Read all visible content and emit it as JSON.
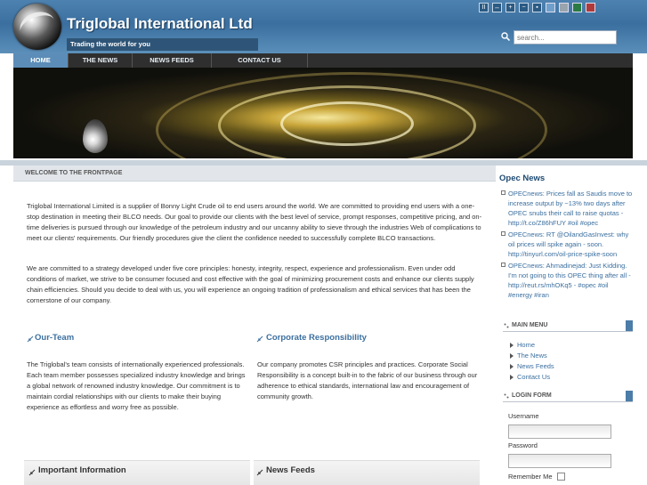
{
  "header": {
    "title": "Triglobal International Ltd",
    "tagline": "Trading the world for you",
    "search_placeholder": "search...",
    "toolbar": {
      "buttons": [
        "II",
        "↔",
        "+",
        "−",
        "▪"
      ],
      "swatches": [
        "#6fa0cc",
        "#9aa4ad",
        "#2a7a44",
        "#b03a3a"
      ]
    }
  },
  "nav": {
    "items": [
      {
        "label": "HOME",
        "active": true
      },
      {
        "label": "THE NEWS",
        "active": false
      },
      {
        "label": "NEWS FEEDS",
        "active": false
      },
      {
        "label": "CONTACT US",
        "active": false
      }
    ]
  },
  "main": {
    "heading": "WELCOME TO THE FRONTPAGE",
    "intro_p1": "Triglobal International Limited is a supplier of Bonny Light Crude oil to end users around the world. We are committed to providing end users with a one-stop destination in meeting their BLCO needs. Our goal to provide our clients with the best level of service, prompt responses, competitive pricing, and on-time deliveries is pursued through our knowledge of the petroleum industry and our uncanny ability to sieve through the industries Web of complications to meet our clients' requirements.  Our friendly procedures give the client the confidence needed to successfully complete BLCO transactions.",
    "intro_p2": "We are committed to a strategy developed under five core principles: honesty, integrity, respect, experience and professionalism. Even under odd conditions of market, we strive to be consumer focused and cost effective with the goal of minimizing procurement costs and enhance our clients supply chain efficiencies. Should you decide to deal with us, you will experience an ongoing tradition of professionalism and ethical services that has been the cornerstone of our company.",
    "team_title": "Our-Team",
    "team_text": "The Triglobal's team consists of internationally experienced professionals. Each team member possesses specialized industry knowledge and brings a global network of renowned industry knowledge. Our commitment  is to maintain cordial relationships with our clients to make their buying experience as effortless and worry free as possible.",
    "csr_title": "Corporate Responsibility",
    "csr_text": "Our company promotes CSR principles and practices.  Corporate Social Responsibility is a concept built-in to the fabric of our business through our adherence to ethical standards, international law and encouragement of community growth.",
    "info_title": "Important Information",
    "feeds_title": "News Feeds"
  },
  "sidebar": {
    "opec_title": "Opec News",
    "opec_items": [
      "OPECnews: Prices fall as Saudis move to increase output by ~13% two days after OPEC snubs their call to raise quotas - http://t.co/Z86hFUY #oil #opec",
      "OPECnews: RT @OilandGasInvest: why oil prices will spike again - soon. http://tinyurl.com/oil-price-spike-soon",
      "OPECnews: Ahmadinejad: Just Kidding. I'm not going to this OPEC thing after all - http://reut.rs/mhOKq5 - #opec #oil #energy #iran"
    ],
    "main_menu_title": "MAIN MENU",
    "menu_items": [
      "Home",
      "The News",
      "News Feeds",
      "Contact Us"
    ],
    "login_title": "LOGIN FORM",
    "username_label": "Username",
    "password_label": "Password",
    "remember_label": "Remember Me"
  }
}
